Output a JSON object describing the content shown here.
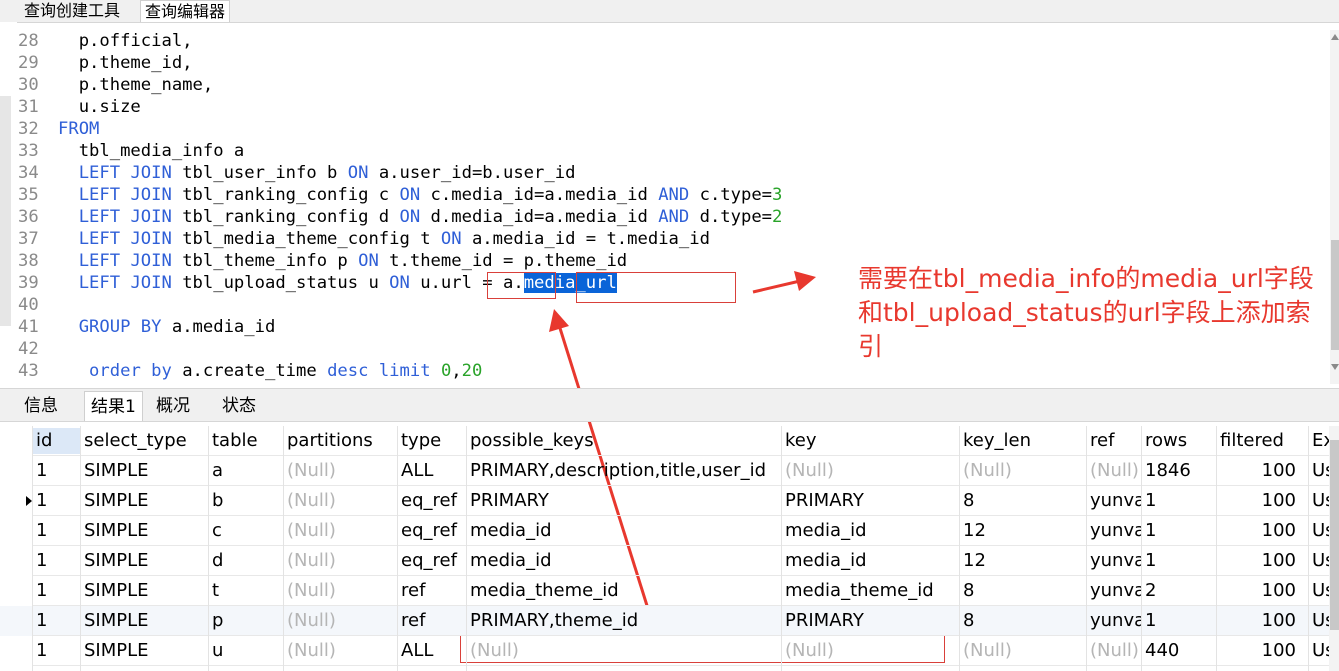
{
  "top_tabs": [
    "查询创建工具",
    "查询编辑器"
  ],
  "editor": {
    "lines": [
      {
        "n": "28",
        "tokens": [
          {
            "t": "  p.official,",
            "c": "tx"
          }
        ]
      },
      {
        "n": "29",
        "tokens": [
          {
            "t": "  p.theme_id,",
            "c": "tx"
          }
        ]
      },
      {
        "n": "30",
        "tokens": [
          {
            "t": "  p.theme_name,",
            "c": "tx"
          }
        ]
      },
      {
        "n": "31",
        "tokens": [
          {
            "t": "  u.size",
            "c": "tx"
          }
        ]
      },
      {
        "n": "32",
        "tokens": [
          {
            "t": "FROM",
            "c": "kw"
          }
        ]
      },
      {
        "n": "33",
        "tokens": [
          {
            "t": "  tbl_media_info a",
            "c": "tx"
          }
        ]
      },
      {
        "n": "34",
        "tokens": [
          {
            "t": "  ",
            "c": "tx"
          },
          {
            "t": "LEFT JOIN",
            "c": "kw"
          },
          {
            "t": " tbl_user_info b ",
            "c": "tx"
          },
          {
            "t": "ON",
            "c": "kw"
          },
          {
            "t": " a.user_id=b.user_id",
            "c": "tx"
          }
        ]
      },
      {
        "n": "35",
        "tokens": [
          {
            "t": "  ",
            "c": "tx"
          },
          {
            "t": "LEFT JOIN",
            "c": "kw"
          },
          {
            "t": " tbl_ranking_config c ",
            "c": "tx"
          },
          {
            "t": "ON",
            "c": "kw"
          },
          {
            "t": " c.media_id=a.media_id ",
            "c": "tx"
          },
          {
            "t": "AND",
            "c": "kw"
          },
          {
            "t": " c.type=",
            "c": "tx"
          },
          {
            "t": "3",
            "c": "num"
          }
        ]
      },
      {
        "n": "36",
        "tokens": [
          {
            "t": "  ",
            "c": "tx"
          },
          {
            "t": "LEFT JOIN",
            "c": "kw"
          },
          {
            "t": " tbl_ranking_config d ",
            "c": "tx"
          },
          {
            "t": "ON",
            "c": "kw"
          },
          {
            "t": " d.media_id=a.media_id ",
            "c": "tx"
          },
          {
            "t": "AND",
            "c": "kw"
          },
          {
            "t": " d.type=",
            "c": "tx"
          },
          {
            "t": "2",
            "c": "num"
          }
        ]
      },
      {
        "n": "37",
        "tokens": [
          {
            "t": "  ",
            "c": "tx"
          },
          {
            "t": "LEFT JOIN",
            "c": "kw"
          },
          {
            "t": " tbl_media_theme_config t ",
            "c": "tx"
          },
          {
            "t": "ON",
            "c": "kw"
          },
          {
            "t": " a.media_id = t.media_id",
            "c": "tx"
          }
        ]
      },
      {
        "n": "38",
        "tokens": [
          {
            "t": "  ",
            "c": "tx"
          },
          {
            "t": "LEFT JOIN",
            "c": "kw"
          },
          {
            "t": " tbl_theme_info p ",
            "c": "tx"
          },
          {
            "t": "ON",
            "c": "kw"
          },
          {
            "t": " t.theme_id = p.theme_id",
            "c": "tx"
          }
        ]
      },
      {
        "n": "39",
        "tokens": [
          {
            "t": "  ",
            "c": "tx"
          },
          {
            "t": "LEFT JOIN",
            "c": "kw"
          },
          {
            "t": " tbl_upload_status u ",
            "c": "tx"
          },
          {
            "t": "ON",
            "c": "kw"
          },
          {
            "t": " u.url = a.",
            "c": "tx"
          },
          {
            "t": "media_url",
            "c": "sel"
          }
        ]
      },
      {
        "n": "40",
        "tokens": []
      },
      {
        "n": "41",
        "tokens": [
          {
            "t": "  ",
            "c": "tx"
          },
          {
            "t": "GROUP BY",
            "c": "kw"
          },
          {
            "t": " a.media_id",
            "c": "tx"
          }
        ]
      },
      {
        "n": "42",
        "tokens": []
      },
      {
        "n": "43",
        "tokens": [
          {
            "t": "   ",
            "c": "tx"
          },
          {
            "t": "order by",
            "c": "kw"
          },
          {
            "t": " a.create_time ",
            "c": "tx"
          },
          {
            "t": "desc",
            "c": "kw"
          },
          {
            "t": " ",
            "c": "tx"
          },
          {
            "t": "limit",
            "c": "kw"
          },
          {
            "t": " ",
            "c": "tx"
          },
          {
            "t": "0",
            "c": "num"
          },
          {
            "t": ",",
            "c": "tx"
          },
          {
            "t": "20",
            "c": "num"
          }
        ]
      }
    ]
  },
  "annotation": {
    "text": "需要在tbl_media_info的media_url字段和tbl_upload_status的url字段上添加索引",
    "color": "#e8382e"
  },
  "result_tabs": [
    "信息",
    "结果1",
    "概况",
    "状态"
  ],
  "grid": {
    "columns": [
      "id",
      "select_type",
      "table",
      "partitions",
      "type",
      "possible_keys",
      "key",
      "key_len",
      "ref",
      "rows",
      "filtered",
      "Ex"
    ],
    "rows": [
      [
        "1",
        "SIMPLE",
        "a",
        "(Null)",
        "ALL",
        "PRIMARY,description,title,user_id",
        "(Null)",
        "(Null)",
        "(Null)",
        "1846",
        "100",
        "Us"
      ],
      [
        "1",
        "SIMPLE",
        "b",
        "(Null)",
        "eq_ref",
        "PRIMARY",
        "PRIMARY",
        "8",
        "yunva",
        "1",
        "100",
        "Us"
      ],
      [
        "1",
        "SIMPLE",
        "c",
        "(Null)",
        "eq_ref",
        "media_id",
        "media_id",
        "12",
        "yunva",
        "1",
        "100",
        "Us"
      ],
      [
        "1",
        "SIMPLE",
        "d",
        "(Null)",
        "eq_ref",
        "media_id",
        "media_id",
        "12",
        "yunva",
        "1",
        "100",
        "Us"
      ],
      [
        "1",
        "SIMPLE",
        "t",
        "(Null)",
        "ref",
        "media_theme_id",
        "media_theme_id",
        "8",
        "yunva",
        "2",
        "100",
        "Us"
      ],
      [
        "1",
        "SIMPLE",
        "p",
        "(Null)",
        "ref",
        "PRIMARY,theme_id",
        "PRIMARY",
        "8",
        "yunva",
        "1",
        "100",
        "Us"
      ],
      [
        "1",
        "SIMPLE",
        "u",
        "(Null)",
        "ALL",
        "(Null)",
        "(Null)",
        "(Null)",
        "(Null)",
        "440",
        "100",
        "Us"
      ]
    ],
    "current_row_index": 1
  }
}
